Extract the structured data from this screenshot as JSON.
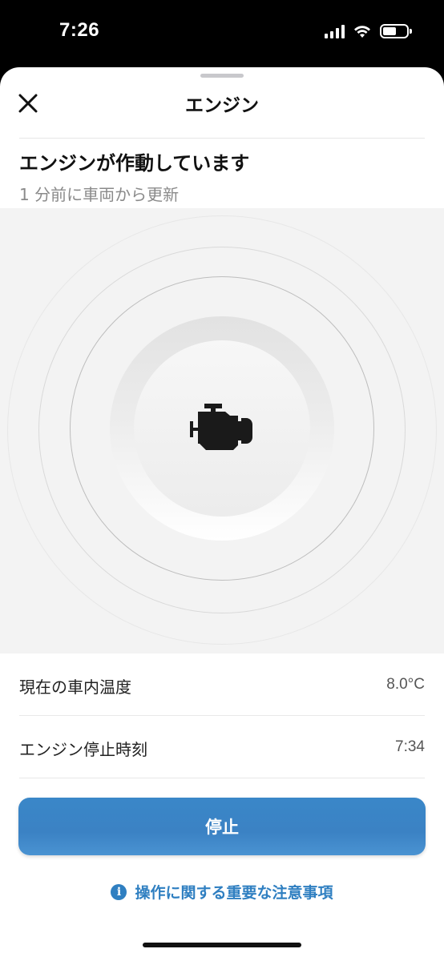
{
  "status_bar": {
    "time": "7:26"
  },
  "header": {
    "title": "エンジン"
  },
  "engine_status": {
    "title": "エンジンが作動しています",
    "subtitle": "1 分前に車両から更新"
  },
  "info_rows": [
    {
      "label": "現在の車内温度",
      "value": "8.0°C"
    },
    {
      "label": "エンジン停止時刻",
      "value": "7:34"
    }
  ],
  "actions": {
    "stop_label": "停止",
    "notice_label": "操作に関する重要な注意事項"
  },
  "icons": {
    "close": "close-icon",
    "engine": "engine-icon",
    "info": "info-icon"
  },
  "colors": {
    "accent": "#2f7fc1",
    "button": "#3b82c4"
  }
}
